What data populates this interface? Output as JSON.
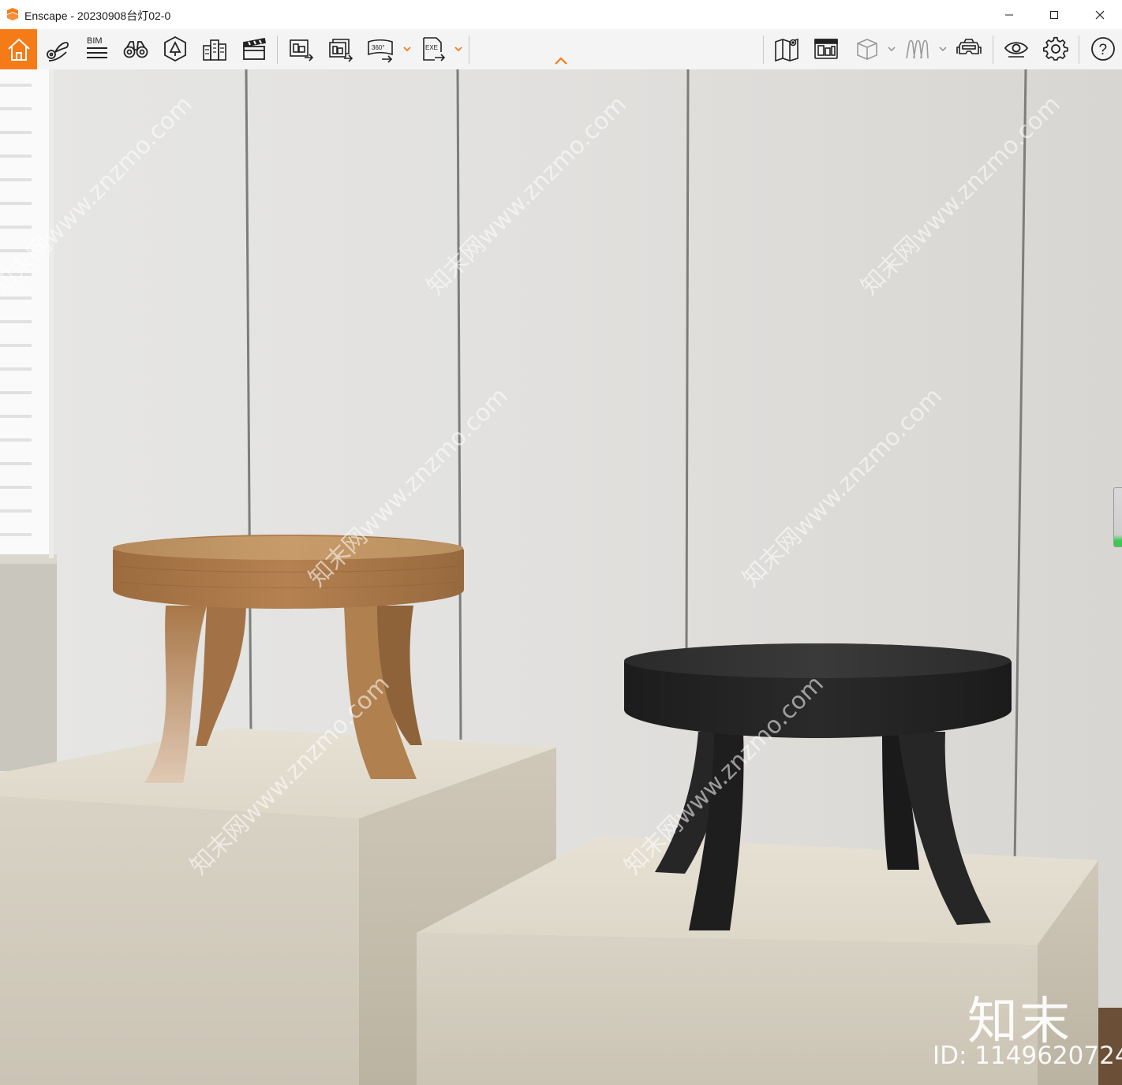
{
  "window": {
    "title": "Enscape - 20230908台灯02-0",
    "brand_color": "#f57b17"
  },
  "toolbar": {
    "left_tools": [
      {
        "name": "home",
        "icon": "home-icon",
        "active": true
      },
      {
        "name": "views",
        "icon": "map-pin-icon"
      },
      {
        "name": "bim",
        "icon": "bim-icon",
        "label": "BIM"
      },
      {
        "name": "binoculars",
        "icon": "binoculars-icon"
      },
      {
        "name": "assets",
        "icon": "tree-icon"
      },
      {
        "name": "buildings",
        "icon": "buildings-icon"
      },
      {
        "name": "video",
        "icon": "clapperboard-icon"
      },
      {
        "name": "render-image",
        "icon": "render-image-icon"
      },
      {
        "name": "batch-render",
        "icon": "batch-render-icon"
      },
      {
        "name": "panorama",
        "icon": "panorama-icon",
        "label": "360°"
      },
      {
        "name": "export-exe",
        "icon": "exe-export-icon",
        "label": "EXE"
      }
    ],
    "right_tools": [
      {
        "name": "map",
        "icon": "map-icon"
      },
      {
        "name": "atlas",
        "icon": "atlas-icon"
      },
      {
        "name": "object-cube",
        "icon": "cube-icon"
      },
      {
        "name": "material",
        "icon": "material-icon"
      },
      {
        "name": "vr",
        "icon": "vr-headset-icon"
      },
      {
        "name": "visibility",
        "icon": "eye-icon"
      },
      {
        "name": "settings",
        "icon": "gear-icon"
      },
      {
        "name": "help",
        "icon": "help-icon",
        "label": "?"
      }
    ]
  },
  "viewport": {
    "watermark_brand": "知末",
    "watermark_id": "ID: 1149620724",
    "watermark_url": "知末网www.znzmo.com"
  }
}
